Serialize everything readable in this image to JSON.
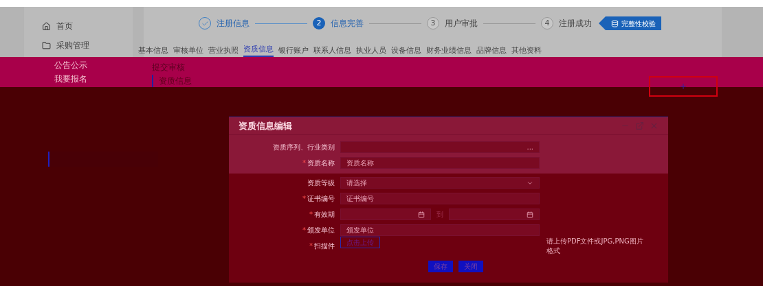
{
  "sidebar": {
    "items": [
      {
        "label": "首页",
        "kind": "home"
      },
      {
        "label": "采购管理",
        "kind": "folder"
      },
      {
        "label": "公告公示",
        "kind": "sub"
      },
      {
        "label": "我要报名",
        "kind": "sub"
      }
    ],
    "selected_item": {
      "selected": true
    }
  },
  "steps": [
    {
      "label": "注册信息",
      "completed": true,
      "selected": false
    },
    {
      "number": "2",
      "label": "信息完善",
      "completed": false,
      "selected": true
    },
    {
      "number": "3",
      "label": "用户审批",
      "completed": false,
      "selected": false
    },
    {
      "number": "4",
      "label": "注册成功",
      "completed": false,
      "selected": false
    }
  ],
  "check_button": "完整性校验",
  "tabs": [
    {
      "label": "基本信息",
      "selected": false
    },
    {
      "label": "审核单位",
      "selected": false
    },
    {
      "label": "营业执照",
      "selected": false
    },
    {
      "label": "资质信息",
      "selected": true
    },
    {
      "label": "银行账户",
      "selected": false
    },
    {
      "label": "联系人信息",
      "selected": false
    },
    {
      "label": "执业人员",
      "selected": false
    },
    {
      "label": "设备信息",
      "selected": false
    },
    {
      "label": "财务业绩信息",
      "selected": false
    },
    {
      "label": "品牌信息",
      "selected": false
    },
    {
      "label": "其他资料",
      "selected": false
    }
  ],
  "submit_button": "提交审核",
  "section_title": "资质信息",
  "dialog": {
    "title": "资质信息编辑",
    "fields": [
      {
        "label": "资质序列、行业类别",
        "kind": "picker",
        "value": "..."
      },
      {
        "label": "资质名称",
        "required_mark": "*",
        "kind": "text",
        "placeholder": "资质名称"
      },
      {
        "label": "资质等级",
        "kind": "select",
        "placeholder": "请选择"
      },
      {
        "label": "证书编号",
        "required_mark": "*",
        "kind": "text",
        "placeholder": "证书编号"
      },
      {
        "label": "有效期",
        "required_mark": "*",
        "kind": "daterange",
        "separator": "到"
      },
      {
        "label": "颁发单位",
        "required_mark": "*",
        "kind": "text",
        "placeholder": "颁发单位"
      },
      {
        "label": "扫描件",
        "required_mark": "*",
        "kind": "upload",
        "button": "点击上传",
        "hint": "请上传PDF文件或JPG,PNG图片格式"
      }
    ],
    "buttons": [
      "保存",
      "关闭"
    ]
  }
}
